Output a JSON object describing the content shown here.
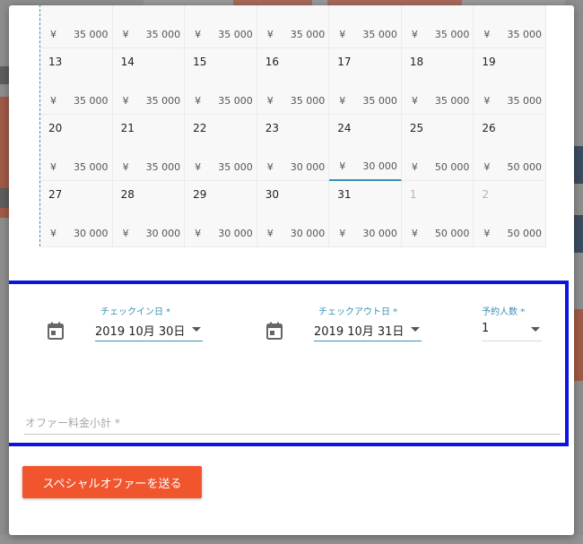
{
  "colors": {
    "accent": "#3a8fb5",
    "highlight_border": "#0a16e0",
    "primary_button": "#f0552d"
  },
  "calendar": {
    "currency": "¥",
    "partial_row": [
      {
        "price": "35 000"
      },
      {
        "price": "35 000"
      },
      {
        "price": "35 000"
      },
      {
        "price": "35 000"
      },
      {
        "price": "35 000"
      },
      {
        "price": "35 000"
      },
      {
        "price": "35 000"
      }
    ],
    "rows": [
      [
        {
          "day": "13",
          "price": "35 000"
        },
        {
          "day": "14",
          "price": "35 000"
        },
        {
          "day": "15",
          "price": "35 000"
        },
        {
          "day": "16",
          "price": "35 000"
        },
        {
          "day": "17",
          "price": "35 000"
        },
        {
          "day": "18",
          "price": "35 000"
        },
        {
          "day": "19",
          "price": "35 000"
        }
      ],
      [
        {
          "day": "20",
          "price": "35 000"
        },
        {
          "day": "21",
          "price": "35 000"
        },
        {
          "day": "22",
          "price": "35 000"
        },
        {
          "day": "23",
          "price": "30 000"
        },
        {
          "day": "24",
          "price": "30 000",
          "selected": true
        },
        {
          "day": "25",
          "price": "50 000"
        },
        {
          "day": "26",
          "price": "50 000"
        }
      ],
      [
        {
          "day": "27",
          "price": "30 000"
        },
        {
          "day": "28",
          "price": "30 000"
        },
        {
          "day": "29",
          "price": "30 000"
        },
        {
          "day": "30",
          "price": "30 000"
        },
        {
          "day": "31",
          "price": "30 000"
        },
        {
          "day": "1",
          "price": "50 000",
          "muted": true
        },
        {
          "day": "2",
          "price": "50 000",
          "muted": true
        }
      ]
    ]
  },
  "form": {
    "checkin": {
      "label": "チェックイン日 *",
      "value": "2019 10月 30日",
      "icon": "calendar-icon"
    },
    "checkout": {
      "label": "チェックアウト日 *",
      "value": "2019 10月 31日",
      "icon": "calendar-icon"
    },
    "guests": {
      "label": "予約人数 *",
      "value": "1"
    },
    "offer_subtotal": {
      "placeholder": "オファー料金小計 *",
      "value": ""
    }
  },
  "send_button": {
    "label": "スペシャルオファーを送る"
  }
}
